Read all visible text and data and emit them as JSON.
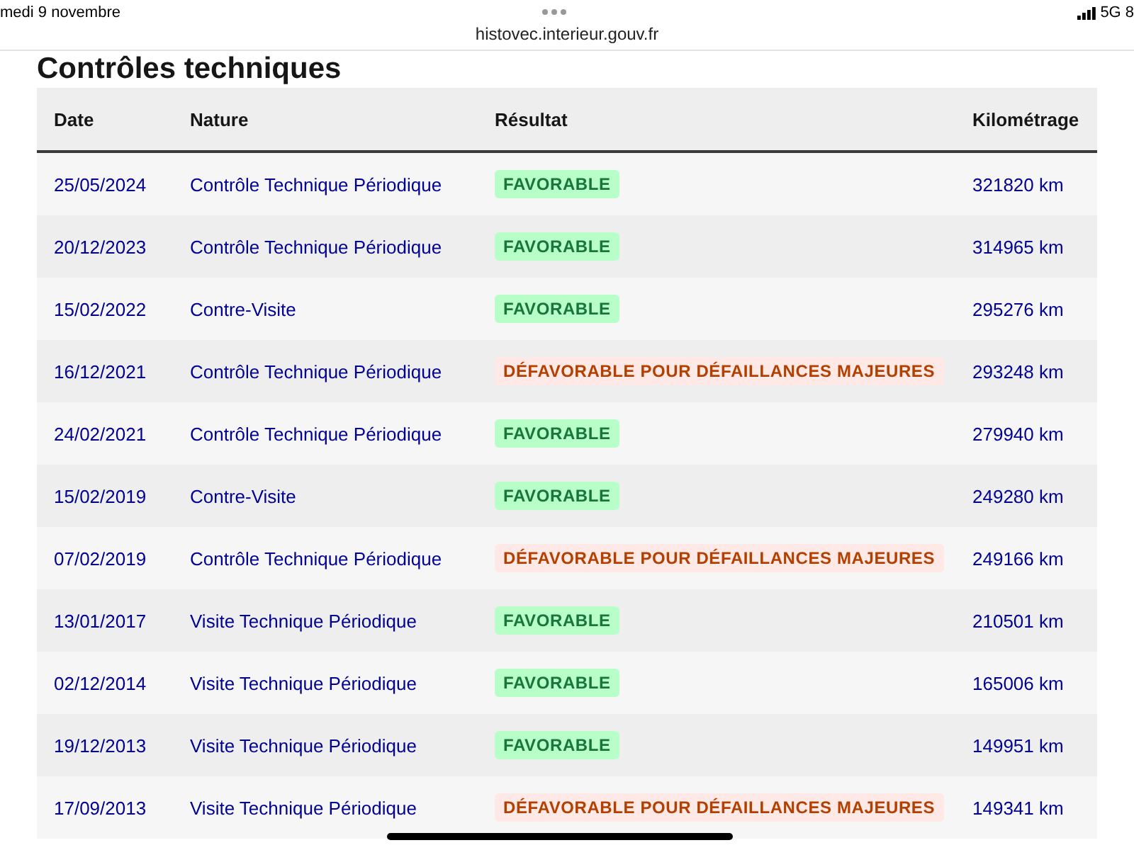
{
  "status_bar": {
    "date": "medi 9 novembre",
    "url": "histovec.interieur.gouv.fr",
    "network": "5G",
    "battery": "8"
  },
  "heading": "Contrôles techniques",
  "table": {
    "columns": [
      "Date",
      "Nature",
      "Résultat",
      "Kilométrage"
    ],
    "rows": [
      {
        "date": "25/05/2024",
        "nature": "Contrôle Technique Périodique",
        "result": {
          "kind": "favorable",
          "label": "FAVORABLE"
        },
        "mileage": "321820 km"
      },
      {
        "date": "20/12/2023",
        "nature": "Contrôle Technique Périodique",
        "result": {
          "kind": "favorable",
          "label": "FAVORABLE"
        },
        "mileage": "314965 km"
      },
      {
        "date": "15/02/2022",
        "nature": "Contre-Visite",
        "result": {
          "kind": "favorable",
          "label": "FAVORABLE"
        },
        "mileage": "295276 km"
      },
      {
        "date": "16/12/2021",
        "nature": "Contrôle Technique Périodique",
        "result": {
          "kind": "unfavorable",
          "label": "DÉFAVORABLE POUR DÉFAILLANCES MAJEURES"
        },
        "mileage": "293248 km"
      },
      {
        "date": "24/02/2021",
        "nature": "Contrôle Technique Périodique",
        "result": {
          "kind": "favorable",
          "label": "FAVORABLE"
        },
        "mileage": "279940 km"
      },
      {
        "date": "15/02/2019",
        "nature": "Contre-Visite",
        "result": {
          "kind": "favorable",
          "label": "FAVORABLE"
        },
        "mileage": "249280 km"
      },
      {
        "date": "07/02/2019",
        "nature": "Contrôle Technique Périodique",
        "result": {
          "kind": "unfavorable",
          "label": "DÉFAVORABLE POUR DÉFAILLANCES MAJEURES"
        },
        "mileage": "249166 km"
      },
      {
        "date": "13/01/2017",
        "nature": "Visite Technique Périodique",
        "result": {
          "kind": "favorable",
          "label": "FAVORABLE"
        },
        "mileage": "210501 km"
      },
      {
        "date": "02/12/2014",
        "nature": "Visite Technique Périodique",
        "result": {
          "kind": "favorable",
          "label": "FAVORABLE"
        },
        "mileage": "165006 km"
      },
      {
        "date": "19/12/2013",
        "nature": "Visite Technique Périodique",
        "result": {
          "kind": "favorable",
          "label": "FAVORABLE"
        },
        "mileage": "149951 km"
      },
      {
        "date": "17/09/2013",
        "nature": "Visite Technique Périodique",
        "result": {
          "kind": "unfavorable",
          "label": "DÉFAVORABLE POUR DÉFAILLANCES MAJEURES"
        },
        "mileage": "149341 km"
      }
    ]
  }
}
